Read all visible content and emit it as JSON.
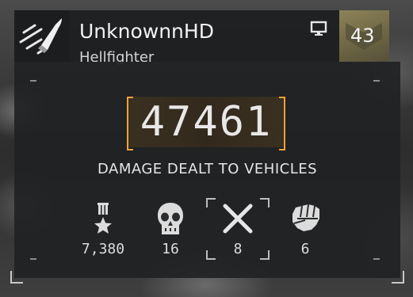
{
  "player": {
    "name": "UnknownnHD",
    "class_name": "Hellfighter",
    "rank": "43",
    "platform_icon": "monitor-icon",
    "emblem_icon": "bullet-emblem-icon"
  },
  "highlight": {
    "value": "47461",
    "label": "DAMAGE DEALT TO VEHICLES",
    "accent_color": "#f0a23a"
  },
  "stats": [
    {
      "icon": "medal-icon",
      "value": "7,380",
      "selected": false
    },
    {
      "icon": "skull-icon",
      "value": "16",
      "selected": false
    },
    {
      "icon": "cross-icon",
      "value": "8",
      "selected": true
    },
    {
      "icon": "fist-icon",
      "value": "6",
      "selected": false
    }
  ]
}
